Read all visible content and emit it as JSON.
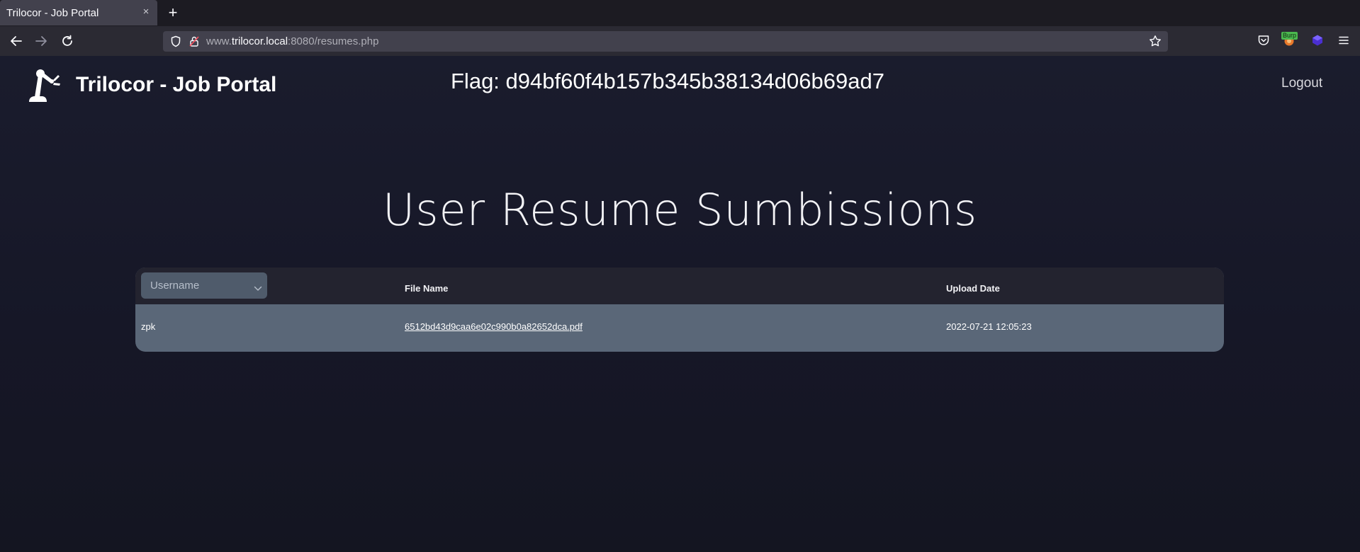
{
  "browser": {
    "tab_title": "Trilocor - Job Portal",
    "tab_close": "×",
    "new_tab": "+",
    "url_domain_prefix": "www.",
    "url_domain": "trilocor.local",
    "url_rest": ":8080/resumes.php",
    "extension_badge": "Burp"
  },
  "header": {
    "brand": "Trilocor - Job Portal",
    "flag": "Flag: d94bf60f4b157b345b38134d06b69ad7",
    "logout": "Logout"
  },
  "main": {
    "heading": "User Resume Sumbissions",
    "table": {
      "filter_placeholder": "Username",
      "columns": [
        "File Name",
        "Upload Date"
      ],
      "rows": [
        {
          "username": "zpk",
          "file_name": "6512bd43d9caa6e02c990b0a82652dca.pdf",
          "upload_date": "2022-07-21 12:05:23"
        }
      ]
    }
  },
  "colors": {
    "page_bg": "#161727",
    "table_header": "#23232f",
    "table_row": "#5a6778",
    "chrome_bg": "#2b2a33"
  }
}
